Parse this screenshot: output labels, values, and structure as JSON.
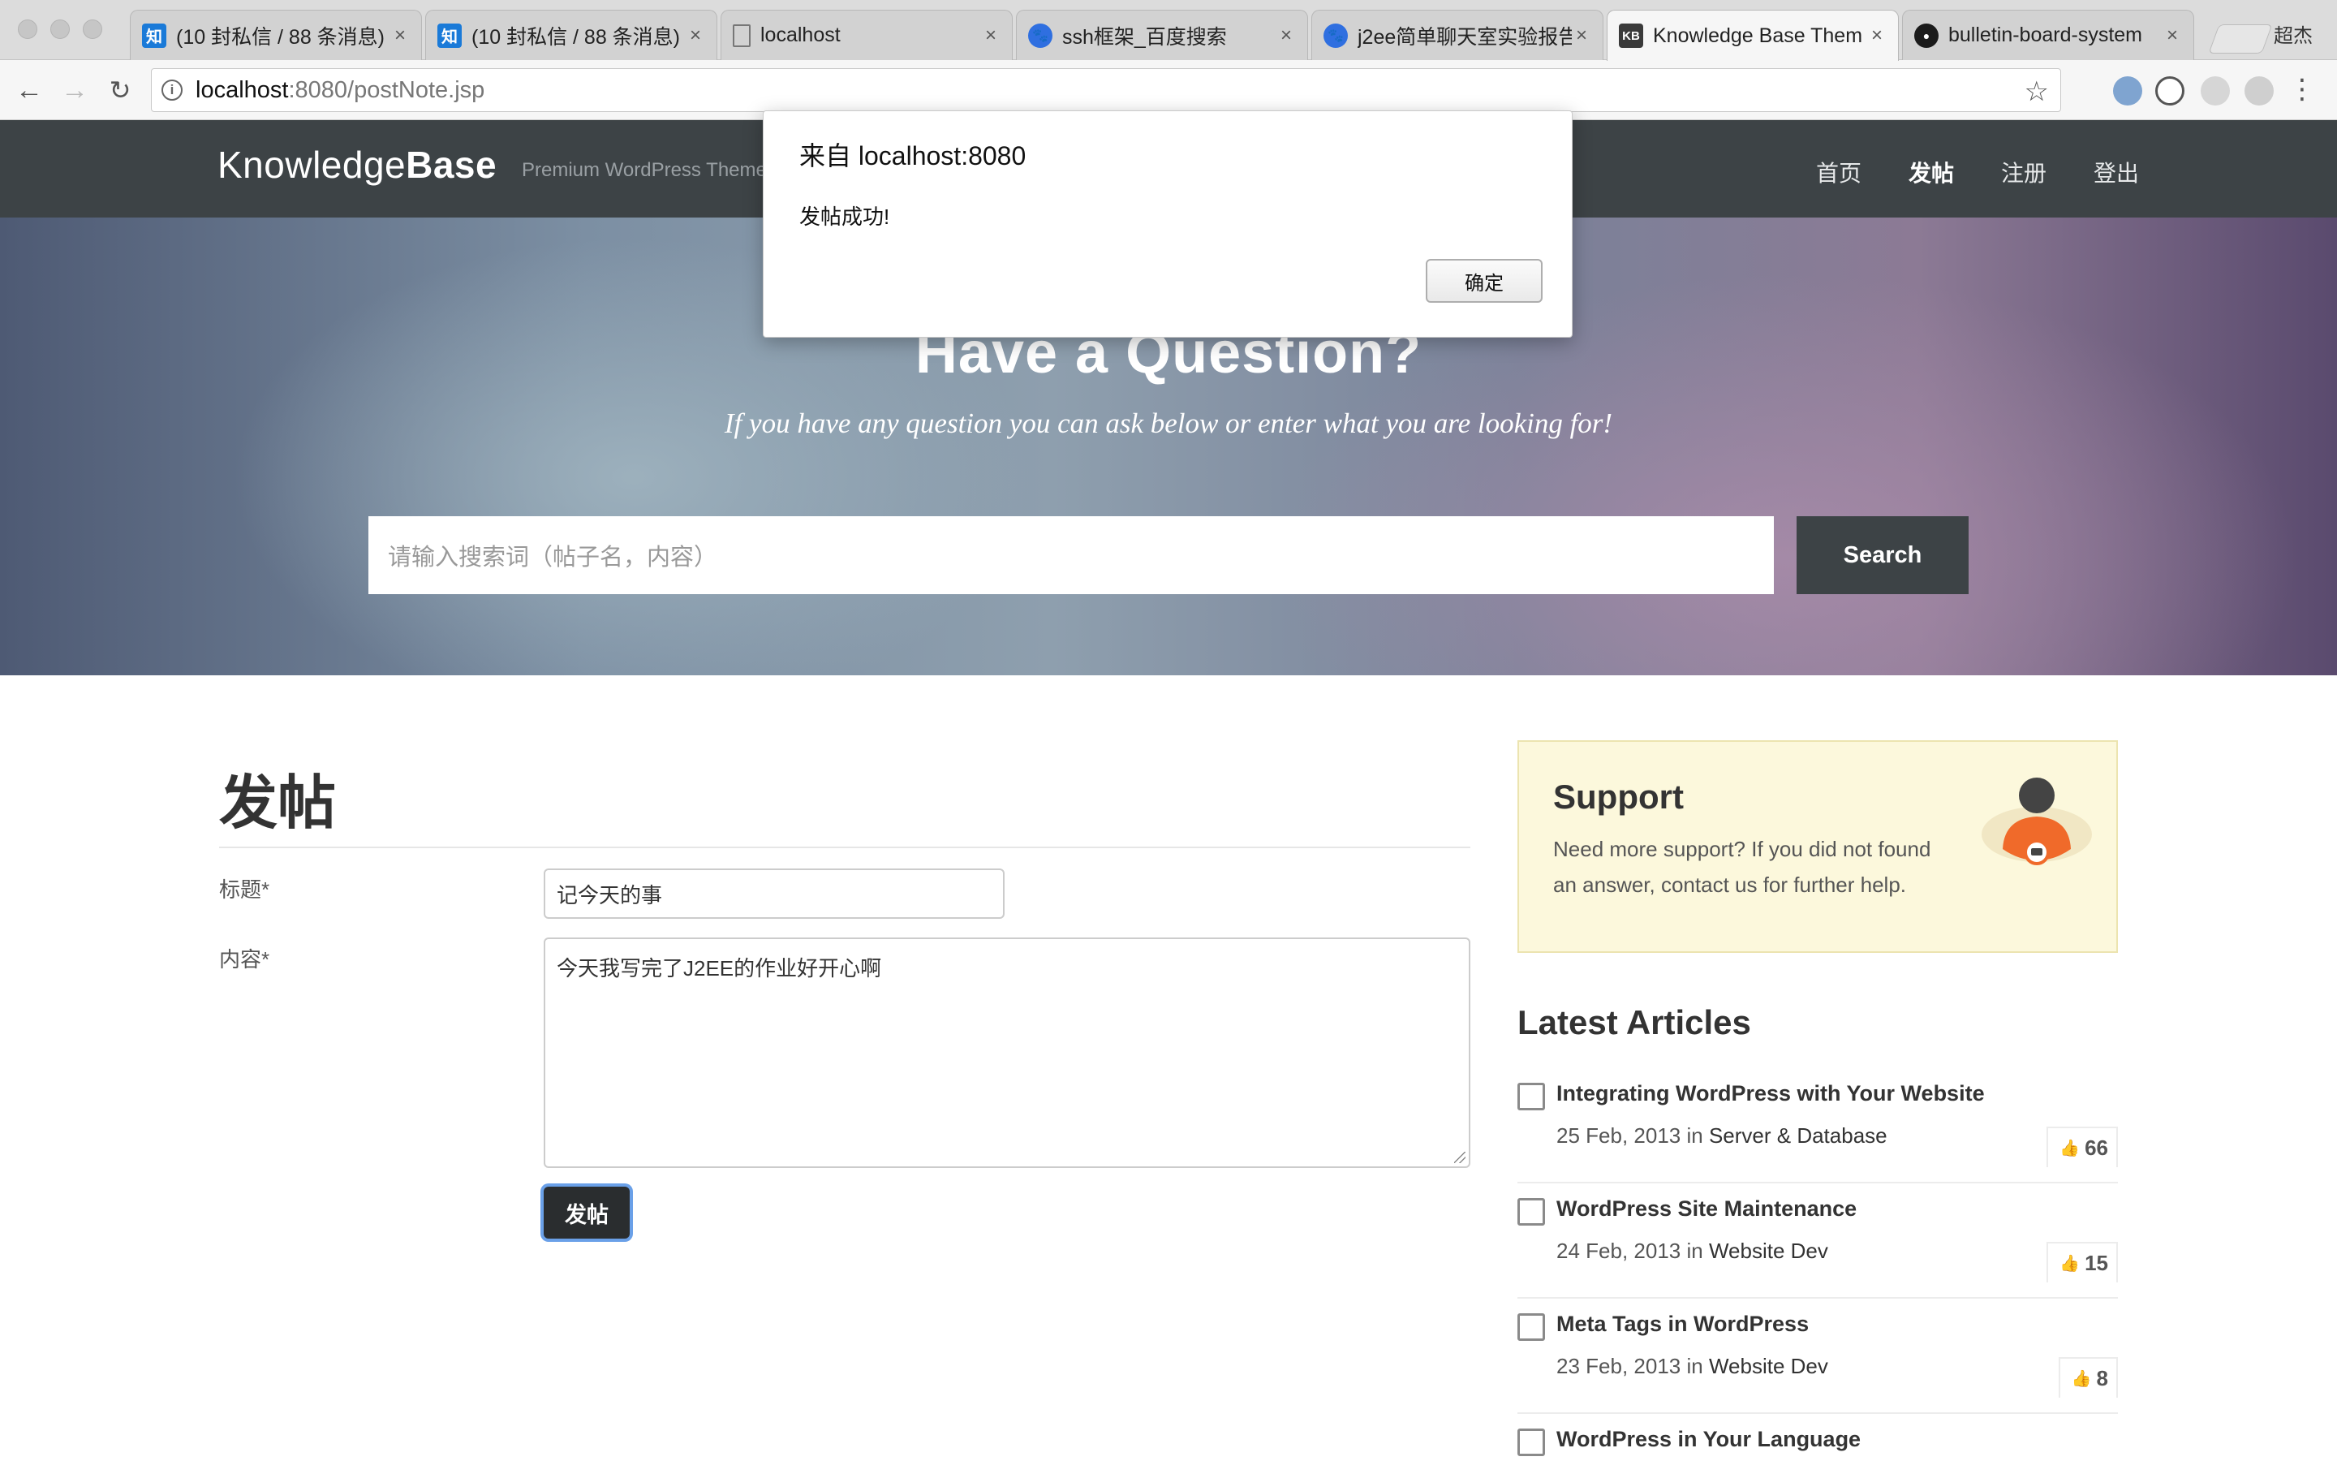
{
  "browser": {
    "tabs": [
      {
        "title": "(10 封私信 / 88 条消息) ",
        "favicon": "zhihu-icon",
        "fav_text": "知",
        "active": false
      },
      {
        "title": "(10 封私信 / 88 条消息) ",
        "favicon": "zhihu-icon",
        "fav_text": "知",
        "active": false
      },
      {
        "title": "localhost",
        "favicon": "page-icon",
        "fav_text": "",
        "active": false
      },
      {
        "title": "ssh框架_百度搜索",
        "favicon": "baidu-icon",
        "fav_text": "🐾",
        "active": false
      },
      {
        "title": "j2ee简单聊天室实验报告",
        "favicon": "baidu-icon",
        "fav_text": "🐾",
        "active": false
      },
      {
        "title": "Knowledge Base Them",
        "favicon": "kb-icon",
        "fav_text": "KB",
        "active": true
      },
      {
        "title": "bulletin-board-system",
        "favicon": "github-icon",
        "fav_text": "●",
        "active": false
      }
    ],
    "profile_name": "超杰",
    "url_host": "localhost",
    "url_rest": ":8080/postNote.jsp"
  },
  "header": {
    "logo_light": "Knowledge",
    "logo_bold": "Base",
    "tagline": "Premium WordPress Theme",
    "nav": [
      {
        "label": "首页",
        "active": false
      },
      {
        "label": "发帖",
        "active": true
      },
      {
        "label": "注册",
        "active": false
      },
      {
        "label": "登出",
        "active": false
      }
    ]
  },
  "hero": {
    "title": "Have a Question?",
    "subtitle": "If you have any question you can ask below or enter what you are looking for!",
    "search_placeholder": "请输入搜索词（帖子名，内容）",
    "search_button": "Search"
  },
  "form": {
    "page_title": "发帖",
    "title_label": "标题*",
    "title_value": "记今天的事",
    "content_label": "内容*",
    "content_value": "今天我写完了J2EE的作业好开心啊",
    "submit_label": "发帖"
  },
  "sidebar": {
    "support_title": "Support",
    "support_text": "Need more support? If you did not found an answer, contact us for further help.",
    "latest_title": "Latest Articles",
    "articles": [
      {
        "title": "Integrating WordPress with Your Website",
        "date": "25 Feb, 2013",
        "in": "in",
        "category": "Server & Database",
        "likes": "66",
        "icon": "edit-icon"
      },
      {
        "title": "WordPress Site Maintenance",
        "date": "24 Feb, 2013",
        "in": "in",
        "category": "Website Dev",
        "likes": "15",
        "icon": "edit-icon"
      },
      {
        "title": "Meta Tags in WordPress",
        "date": "23 Feb, 2013",
        "in": "in",
        "category": "Website Dev",
        "likes": "8",
        "icon": "film-icon"
      },
      {
        "title": "WordPress in Your Language",
        "date": "",
        "in": "",
        "category": "",
        "likes": "",
        "icon": "image-icon"
      }
    ]
  },
  "dialog": {
    "title": "来自 localhost:8080",
    "message": "发帖成功!",
    "ok_label": "确定"
  },
  "colors": {
    "header_bg": "#3d4346",
    "support_bg": "#fcf8dc",
    "button_dark": "#2a2d2f"
  }
}
